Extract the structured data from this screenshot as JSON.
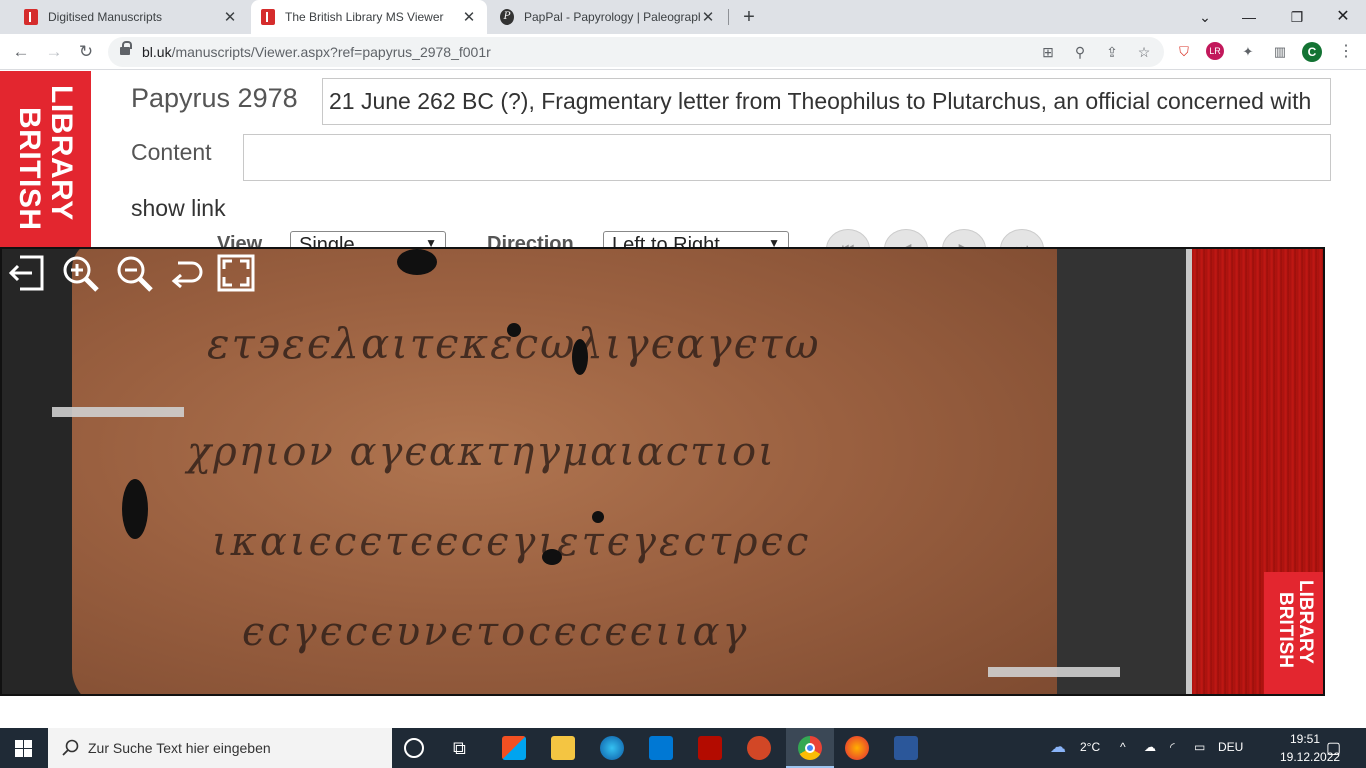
{
  "browser": {
    "tabs": [
      {
        "title": "Digitised Manuscripts",
        "favicon": "british-library-icon"
      },
      {
        "title": "The British Library MS Viewer",
        "favicon": "british-library-icon",
        "active": true
      },
      {
        "title": "PapPal - Papyrology | Paleograph",
        "favicon": "pappal-icon"
      }
    ],
    "url_host": "bl.uk",
    "url_path": "/manuscripts/Viewer.aspx?ref=papyrus_2978_f001r",
    "profile_initial": "C"
  },
  "page": {
    "logo_word_1": "LIBRARY",
    "logo_word_2": "BRITISH",
    "manuscript_title": "Papyrus 2978",
    "description": "21 June 262 BC (?), Fragmentary letter from Theophilus to Plutarchus, an official concerned with",
    "content_label": "Content",
    "content_value": "",
    "show_link": "show link",
    "view_label": "View",
    "view_value": "Single",
    "direction_label": "Direction",
    "direction_value": "Left to Right"
  },
  "viewer": {
    "stamp_word_1": "LIBRARY",
    "stamp_word_2": "BRITISH",
    "tools": [
      "exit-icon",
      "zoom-in-icon",
      "zoom-out-icon",
      "rotate-icon",
      "fullscreen-icon"
    ]
  },
  "taskbar": {
    "search_placeholder": "Zur Suche Text hier eingeben",
    "weather": "2°C",
    "language": "DEU",
    "time": "19:51",
    "date": "19.12.2022"
  }
}
